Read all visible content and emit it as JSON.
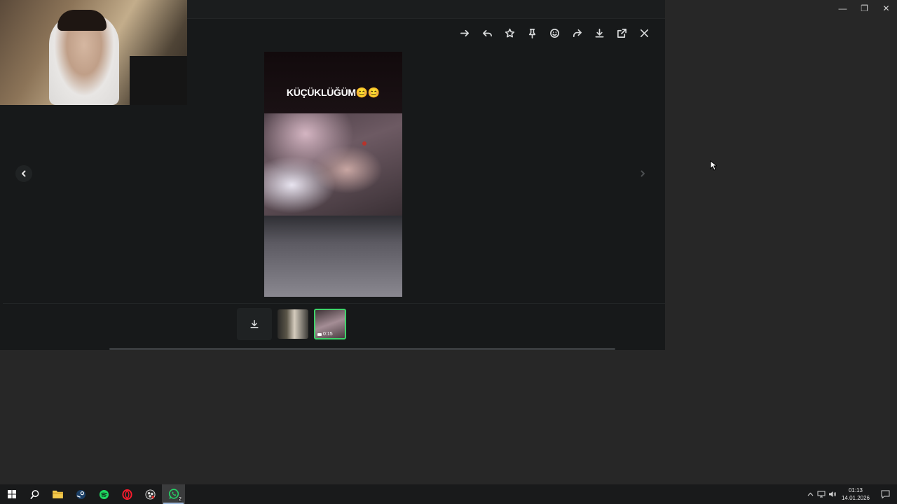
{
  "window": {
    "minimize_glyph": "—",
    "restore_glyph": "❐",
    "close_glyph": "✕"
  },
  "viewer": {
    "toolbar": [
      {
        "name": "forward-arrow-icon",
        "label": "Forward"
      },
      {
        "name": "reply-icon",
        "label": "Reply"
      },
      {
        "name": "star-icon",
        "label": "Star"
      },
      {
        "name": "pin-icon",
        "label": "Pin"
      },
      {
        "name": "emoji-icon",
        "label": "React"
      },
      {
        "name": "share-icon",
        "label": "Share"
      },
      {
        "name": "download-icon",
        "label": "Download"
      },
      {
        "name": "open-external-icon",
        "label": "Open"
      },
      {
        "name": "close-icon",
        "label": "Close"
      }
    ],
    "media": {
      "caption": "KÜÇÜKLÜĞÜM😊😊"
    },
    "thumbnails": [
      {
        "type": "download"
      },
      {
        "type": "photo"
      },
      {
        "type": "video",
        "duration": "0:15",
        "selected": true
      }
    ]
  },
  "taskbar": {
    "apps": [
      {
        "name": "windows-start-icon"
      },
      {
        "name": "search-icon"
      },
      {
        "name": "file-explorer-icon"
      },
      {
        "name": "steam-icon"
      },
      {
        "name": "spotify-icon"
      },
      {
        "name": "opera-icon"
      },
      {
        "name": "obs-icon"
      },
      {
        "name": "whatsapp-icon",
        "badge": "2",
        "active": true
      }
    ],
    "clock": {
      "time": "01:13",
      "date": "14.01.2026"
    }
  },
  "colors": {
    "accent_green": "#3fd36a",
    "viewer_bg": "#17191a",
    "desktop_bg": "#272727"
  }
}
